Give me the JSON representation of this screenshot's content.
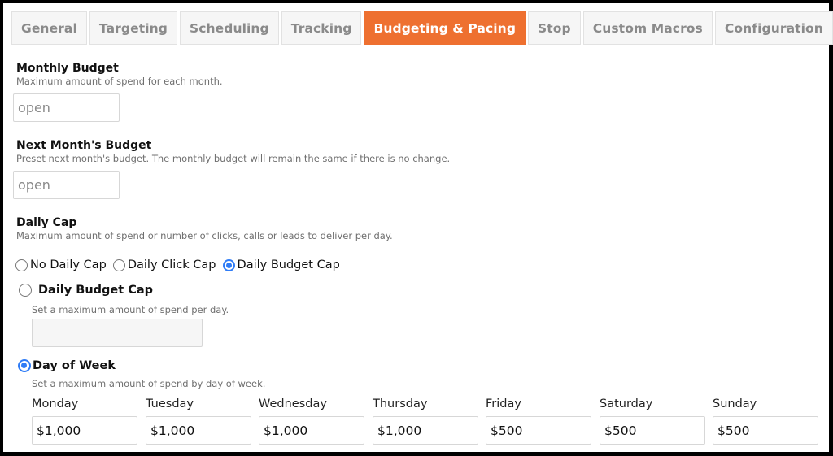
{
  "tabs": [
    {
      "label": "General",
      "active": false
    },
    {
      "label": "Targeting",
      "active": false
    },
    {
      "label": "Scheduling",
      "active": false
    },
    {
      "label": "Tracking",
      "active": false
    },
    {
      "label": "Budgeting & Pacing",
      "active": true
    },
    {
      "label": "Stop",
      "active": false
    },
    {
      "label": "Custom Macros",
      "active": false
    },
    {
      "label": "Configuration",
      "active": false
    }
  ],
  "colors": {
    "active_tab": "#ee7030",
    "radio_selected": "#2f7cf6"
  },
  "monthly_budget": {
    "title": "Monthly Budget",
    "description": "Maximum amount of spend for each month.",
    "placeholder": "open",
    "value": ""
  },
  "next_month_budget": {
    "title": "Next Month's Budget",
    "description": "Preset next month's budget. The monthly budget will remain the same if there is no change.",
    "placeholder": "open",
    "value": ""
  },
  "daily_cap": {
    "title": "Daily Cap",
    "description": "Maximum amount of spend or number of clicks, calls or leads to deliver per day.",
    "options": [
      {
        "label": "No Daily Cap",
        "selected": false
      },
      {
        "label": "Daily Click Cap",
        "selected": false
      },
      {
        "label": "Daily Budget Cap",
        "selected": true
      }
    ],
    "budget_cap": {
      "label": "Daily Budget Cap",
      "selected": false,
      "description": "Set a maximum amount of spend per day.",
      "value": ""
    },
    "day_of_week": {
      "label": "Day of Week",
      "selected": true,
      "description": "Set a maximum amount of spend by day of week.",
      "days": [
        {
          "label": "Monday",
          "value": "$1,000"
        },
        {
          "label": "Tuesday",
          "value": "$1,000"
        },
        {
          "label": "Wednesday",
          "value": "$1,000"
        },
        {
          "label": "Thursday",
          "value": "$1,000"
        },
        {
          "label": "Friday",
          "value": "$500"
        },
        {
          "label": "Saturday",
          "value": "$500"
        },
        {
          "label": "Sunday",
          "value": "$500"
        }
      ]
    }
  }
}
